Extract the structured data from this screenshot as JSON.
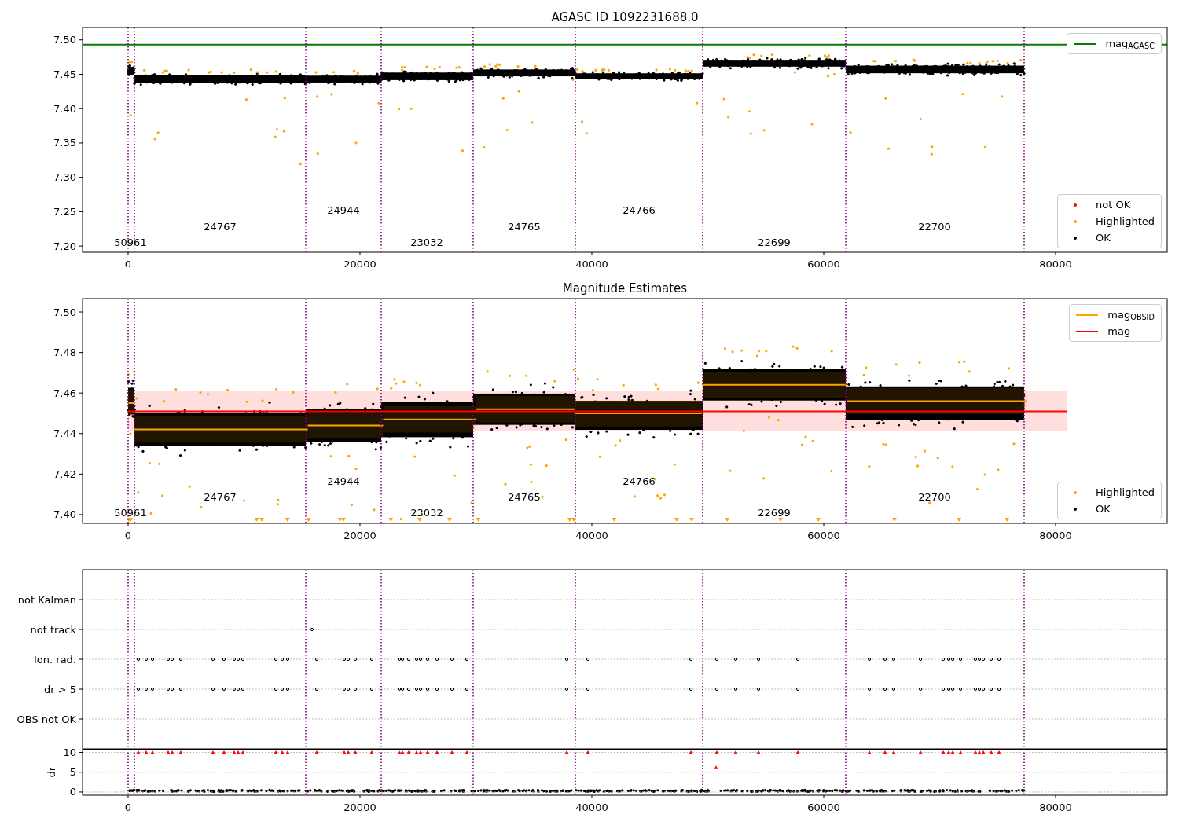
{
  "panels": [
    {
      "chart_data": {
        "type": "scatter",
        "title": "AGASC ID 1092231688.0",
        "xlim": [
          -3932,
          89627
        ],
        "ylim": [
          7.191,
          7.518
        ],
        "xticks": [
          0,
          20000,
          40000,
          60000,
          80000
        ],
        "yticks": [
          {
            "value": 7.2,
            "label": "7.20"
          },
          {
            "value": 7.25,
            "label": "7.25"
          },
          {
            "value": 7.3,
            "label": "7.30"
          },
          {
            "value": 7.35,
            "label": "7.35"
          },
          {
            "value": 7.4,
            "label": "7.40"
          },
          {
            "value": 7.45,
            "label": "7.45"
          },
          {
            "value": 7.5,
            "label": "7.50"
          }
        ],
        "series": [
          {
            "type": "line",
            "color": "#008000",
            "x": [
              -3932,
              89627
            ],
            "values": [
              7.493,
              7.493
            ]
          }
        ],
        "ref_lines": [
          {
            "axis": "x",
            "value": 0
          },
          {
            "axis": "x",
            "value": 542
          },
          {
            "axis": "x",
            "value": 15322
          },
          {
            "axis": "x",
            "value": 21831
          },
          {
            "axis": "x",
            "value": 29763
          },
          {
            "axis": "x",
            "value": 38576
          },
          {
            "axis": "x",
            "value": 49559
          },
          {
            "axis": "x",
            "value": 61898
          },
          {
            "axis": "x",
            "value": 77288
          }
        ],
        "annotations": [
          "50961",
          "24767",
          "24944",
          "23032",
          "24765",
          "24766",
          "22699",
          "22700"
        ]
      },
      "legends": [
        {
          "entries": [
            {
              "kind": "line",
              "label": "mag$_{AGASC}$",
              "color": "#008000"
            }
          ]
        },
        {
          "entries": [
            {
              "kind": "dot",
              "label": "not OK",
              "color": "#ff0000"
            },
            {
              "kind": "dot",
              "label": "Highlighted",
              "color": "#ffa500"
            },
            {
              "kind": "dot",
              "label": "OK",
              "color": "#000000"
            }
          ]
        }
      ]
    },
    {
      "chart_data": {
        "type": "scatter",
        "title": "Magnitude Estimates",
        "xlim": [
          -3932,
          89627
        ],
        "ylim": [
          7.3957,
          7.5066
        ],
        "xticks": [
          0,
          20000,
          40000,
          60000,
          80000
        ],
        "yticks": [
          {
            "value": 7.4,
            "label": "7.40"
          },
          {
            "value": 7.42,
            "label": "7.42"
          },
          {
            "value": 7.44,
            "label": "7.44"
          },
          {
            "value": 7.46,
            "label": "7.46"
          },
          {
            "value": 7.48,
            "label": "7.48"
          },
          {
            "value": 7.5,
            "label": "7.50"
          }
        ],
        "series": [
          {
            "type": "line",
            "color": "#ff0000",
            "x": [
              0,
              81000
            ],
            "values": [
              7.451,
              7.451
            ]
          },
          {
            "type": "line",
            "color": "#ffa500",
            "x": [
              0,
              500,
              null,
              500,
              15500,
              null,
              15500,
              22000,
              null,
              22000,
              30000,
              null,
              30000,
              38500,
              null,
              38500,
              49500,
              null,
              49500,
              62000,
              null,
              62000,
              77500
            ],
            "values": [
              7.455,
              7.455,
              null,
              7.442,
              7.442,
              null,
              7.444,
              7.444,
              null,
              7.447,
              7.447,
              null,
              7.452,
              7.452,
              null,
              7.45,
              7.45,
              null,
              7.464,
              7.464,
              null,
              7.456,
              7.456
            ]
          }
        ],
        "bands": [
          {
            "axis": "y",
            "from": 7.4415,
            "to": 7.461
          }
        ],
        "ref_lines": [
          {
            "axis": "x",
            "value": 0
          },
          {
            "axis": "x",
            "value": 542
          },
          {
            "axis": "x",
            "value": 15322
          },
          {
            "axis": "x",
            "value": 21831
          },
          {
            "axis": "x",
            "value": 29763
          },
          {
            "axis": "x",
            "value": 38576
          },
          {
            "axis": "x",
            "value": 49559
          },
          {
            "axis": "x",
            "value": 61898
          },
          {
            "axis": "x",
            "value": 77288
          }
        ],
        "annotations": [
          "50961",
          "24767",
          "24944",
          "23032",
          "24765",
          "24766",
          "22699",
          "22700"
        ]
      },
      "legends": [
        {
          "entries": [
            {
              "kind": "line",
              "label": "mag$_{OBSID}$",
              "color": "#ffa500"
            },
            {
              "kind": "line",
              "label": "mag",
              "color": "#ff0000"
            }
          ]
        },
        {
          "entries": [
            {
              "kind": "dot",
              "label": "Highlighted",
              "color": "#ffa500"
            },
            {
              "kind": "dot",
              "label": "OK",
              "color": "#000000"
            }
          ]
        }
      ]
    },
    {
      "flag_rows": [
        "not Kalman",
        "not track",
        "Ion. rad.",
        "dr > 5",
        "OBS not OK"
      ]
    },
    {
      "chart_data": {
        "type": "scatter",
        "grid": true,
        "ylabel": "dr",
        "xlim": [
          -3932,
          89627
        ],
        "ylim": [
          -0.8,
          10.8
        ],
        "xticks": [
          0,
          20000,
          40000,
          60000,
          80000
        ],
        "yticks": [
          0,
          5,
          10
        ],
        "series": [
          {
            "type": "scatter",
            "color": "#ff0000",
            "x": [
              881,
              1559,
              2102,
              3458,
              3797,
              4543,
              7322,
              8272,
              9153,
              9492,
              9899,
              12746,
              13289,
              13763,
              16272,
              18645,
              18984,
              19594,
              21017,
              23390,
              23662,
              24205,
              24883,
              25222,
              25832,
              26645,
              27934,
              29222,
              37832,
              39663,
              48545,
              50782,
              52409,
              54376,
              57766,
              63935,
              65291,
              66037,
              68342,
              70309,
              70783,
              71122,
              71800,
              73088,
              73427,
              73766,
              74444,
              75122,
              50714
            ],
            "values": [
              10,
              10,
              10,
              10,
              10,
              10,
              10,
              10,
              10,
              10,
              10,
              10,
              10,
              10,
              10,
              10,
              10,
              10,
              10,
              10,
              10,
              10,
              10,
              10,
              10,
              10,
              10,
              10,
              10,
              10,
              10,
              10,
              10,
              10,
              10,
              10,
              10,
              10,
              10,
              10,
              10,
              10,
              10,
              10,
              10,
              10,
              10,
              10,
              6.2
            ]
          }
        ],
        "ref_lines": [
          {
            "axis": "x",
            "value": 0
          },
          {
            "axis": "x",
            "value": 542
          },
          {
            "axis": "x",
            "value": 15322
          },
          {
            "axis": "x",
            "value": 21831
          },
          {
            "axis": "x",
            "value": 29763
          },
          {
            "axis": "x",
            "value": 38576
          },
          {
            "axis": "x",
            "value": 49559
          },
          {
            "axis": "x",
            "value": 61898
          },
          {
            "axis": "x",
            "value": 77288
          }
        ]
      }
    }
  ]
}
